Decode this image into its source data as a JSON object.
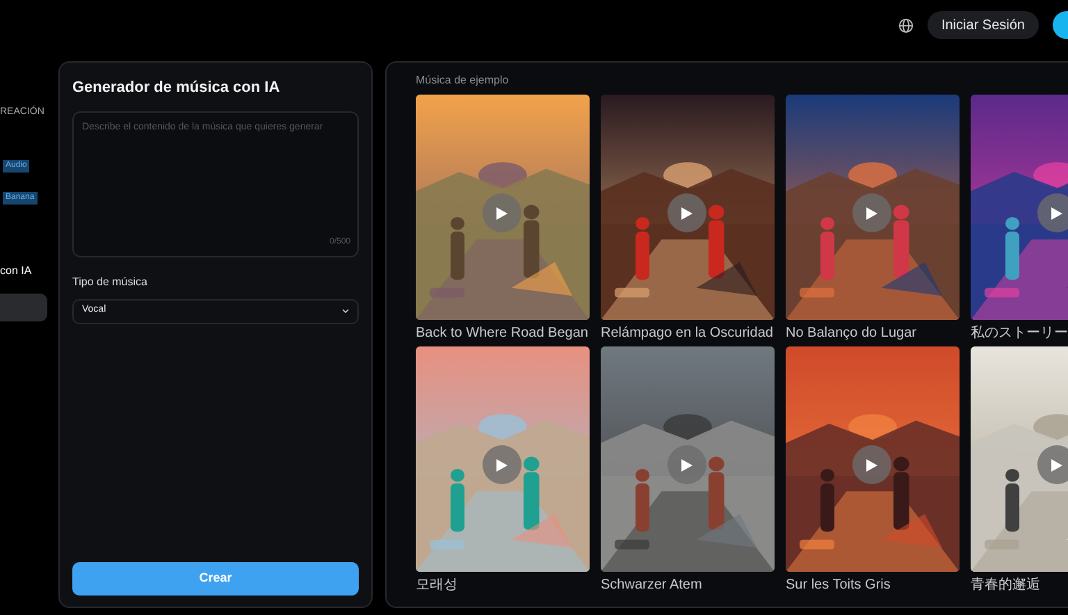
{
  "header": {
    "login_button": "Iniciar Sesión"
  },
  "sidebar": {
    "section_title": "REACIÓN",
    "badges": [
      "Audio",
      "Banana"
    ],
    "items": [
      {
        "label": "con IA",
        "selected": false
      },
      {
        "selected": true
      }
    ]
  },
  "generator": {
    "title": "Generador de música con IA",
    "prompt": {
      "placeholder": "Describe el contenido de la música que quieres generar",
      "counter": "0/500"
    },
    "type_label": "Tipo de música",
    "type_value": "Vocal",
    "create_button": "Crear"
  },
  "gallery": {
    "title": "Música de ejemplo",
    "tracks": [
      {
        "title": "Back to Where Road Began",
        "kind": "picture"
      },
      {
        "title": "Relámpago en la Oscuridad",
        "kind": "picture"
      },
      {
        "title": "No Balanço do Lugar",
        "kind": "picture"
      },
      {
        "title": "私のストーリー",
        "kind": "picture"
      },
      {
        "title": "모래성",
        "kind": "picture"
      },
      {
        "title": "Schwarzer Atem",
        "kind": "picture"
      },
      {
        "title": "Sur les Toits Gris",
        "kind": "picture"
      },
      {
        "title": "青春的邂逅",
        "kind": "picture"
      }
    ]
  }
}
